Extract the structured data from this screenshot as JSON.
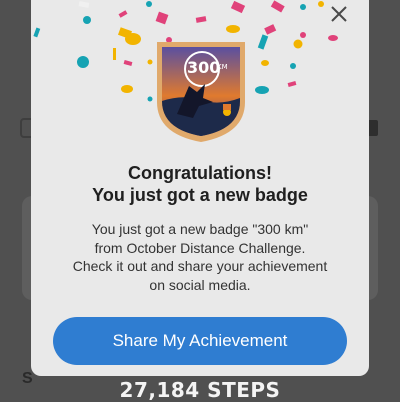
{
  "background": {
    "steps_label": "27,184 STEPS",
    "section_letter": "S"
  },
  "modal": {
    "badge_label": "300",
    "badge_unit": "KM",
    "title_line1": "Congratulations!",
    "title_line2": "You just got a new badge",
    "message_line1": "You just got a new badge \"300 km\"",
    "message_line2": "from October Distance Challenge.",
    "message_line3": "Check it out and share your achievement",
    "message_line4": "on social media.",
    "share_button": "Share My Achievement"
  },
  "icons": {
    "close": "close-icon",
    "badge": "badge-icon"
  },
  "colors": {
    "accent": "#2f7dd1",
    "modal_bg": "#e9e9e9",
    "badge_ring": "#e0a96b",
    "confetti_pink": "#e0427a",
    "confetti_yellow": "#f2b400",
    "confetti_teal": "#16a3b3",
    "confetti_orange": "#f08a1c"
  }
}
